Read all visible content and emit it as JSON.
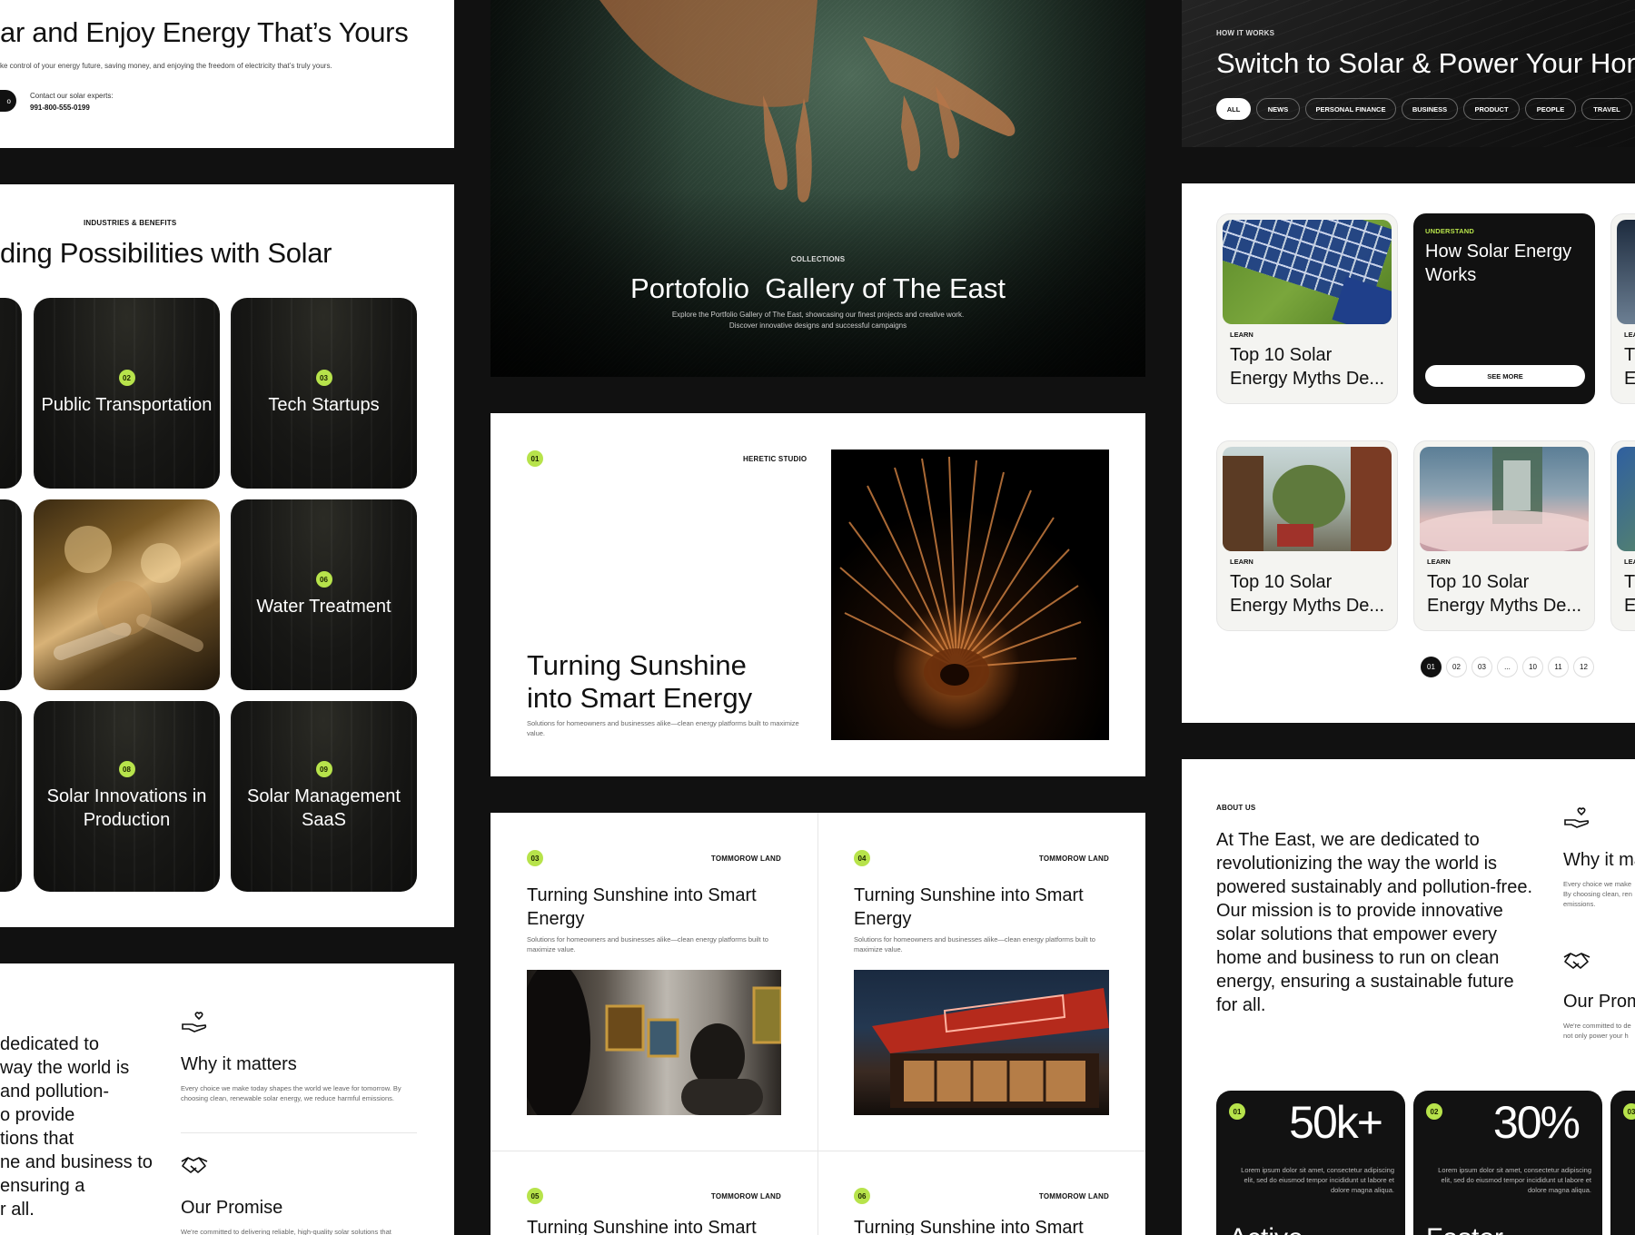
{
  "colors": {
    "accent": "#b7e34b",
    "background": "#111111",
    "panel": "#ffffff"
  },
  "hero_left": {
    "title": "ar and Enjoy Energy That’s Yours",
    "subtitle": "ke control of your energy future, saving money,  and enjoying the freedom of electricity that’s truly yours.",
    "button_fragment": "o",
    "contact_label": "Contact our solar experts:",
    "contact_phone": "991-800-555-0199"
  },
  "industries": {
    "eyebrow": "INDUSTRIES & BENEFITS",
    "title": "ding Possibilities with Solar",
    "tiles": [
      {
        "num": "02",
        "label": "Public Transportation"
      },
      {
        "num": "03",
        "label": "Tech Startups"
      },
      {
        "num": "06",
        "label": "Water Treatment"
      },
      {
        "num": "08",
        "label": "Solar Innovations in Production"
      },
      {
        "num": "09",
        "label": "Solar Management SaaS"
      }
    ]
  },
  "about_left": {
    "text": "dedicated to\nway the world is\nand pollution-\no provide\ntions that\nne and business to\nensuring a\nr all.",
    "item1_icon": "hand-heart-icon",
    "item1_title": "Why it matters",
    "item1_desc": "Every choice we make today shapes the world we leave for tomorrow. By choosing clean, renewable solar energy, we reduce harmful emissions.",
    "item2_icon": "handshake-icon",
    "item2_title": "Our Promise",
    "item2_desc": "We're committed to delivering reliable, high-quality solar solutions that"
  },
  "gallery_hero": {
    "eyebrow": "COLLECTIONS",
    "title": "Portofolio  Gallery of The East",
    "desc_line1": "Explore the Portfolio Gallery of The East, showcasing our finest projects and creative work.",
    "desc_line2": "Discover innovative designs and successful campaigns"
  },
  "feature": {
    "num": "01",
    "studio": "HERETIC STUDIO",
    "title": "Turning Sunshine into Smart Energy",
    "desc": "Solutions for homeowners and businesses alike—clean energy platforms built to maximize value."
  },
  "projects": [
    {
      "num": "03",
      "studio": "TOMMOROW LAND",
      "title": "Turning Sunshine into Smart Energy",
      "desc": "Solutions for homeowners and businesses alike—clean energy platforms built to maximize value."
    },
    {
      "num": "04",
      "studio": "TOMMOROW LAND",
      "title": "Turning Sunshine into Smart Energy",
      "desc": "Solutions for homeowners and businesses alike—clean energy platforms built to maximize value."
    },
    {
      "num": "05",
      "studio": "TOMMOROW LAND",
      "title": "Turning Sunshine into Smart"
    },
    {
      "num": "06",
      "studio": "TOMMOROW LAND",
      "title": "Turning Sunshine into Smart"
    }
  ],
  "how_it_works": {
    "eyebrow": "HOW IT WORKS",
    "title": "Switch to Solar & Power Your Home",
    "chips": [
      "ALL",
      "NEWS",
      "PERSONAL FINANCE",
      "BUSINESS",
      "PRODUCT",
      "PEOPLE",
      "TRAVEL"
    ]
  },
  "blog": {
    "cards": [
      {
        "tag": "LEARN",
        "title": "Top 10 Solar Energy Myths De..."
      },
      {
        "tag": "UNDERSTAND",
        "title": "How Solar Energy Works",
        "button": "SEE MORE"
      },
      {
        "tag": "LEA",
        "title": "T\nE"
      },
      {
        "tag": "LEARN",
        "title": "Top 10 Solar Energy Myths De..."
      },
      {
        "tag": "LEARN",
        "title": "Top 10 Solar Energy Myths De..."
      },
      {
        "tag": "LEA",
        "title": "T\nE"
      }
    ],
    "pagination": [
      "01",
      "02",
      "03",
      "...",
      "10",
      "11",
      "12"
    ],
    "current_page": "01"
  },
  "about_right": {
    "eyebrow": "ABOUT US",
    "text": "At The East, we are dedicated to revolutionizing the way the world is powered sustainably and pollution-free. Our mission is to provide innovative solar solutions that empower every home and business to run on clean energy, ensuring a sustainable future for all.",
    "item1_icon": "hand-heart-icon",
    "item1_title": "Why it ma",
    "item1_desc": "Every choice we make\nBy choosing clean, ren\nemissions.",
    "item2_icon": "handshake-icon",
    "item2_title": "Our Prom",
    "item2_desc": "We're committed to de\nnot only power your h",
    "stats": [
      {
        "num": "01",
        "value": "50k+",
        "desc": "Lorem ipsum dolor sit amet, consectetur adipiscing elit, sed do eiusmod tempor incididunt ut labore et dolore magna aliqua.",
        "word": "Active"
      },
      {
        "num": "02",
        "value": "30%",
        "desc": "Lorem ipsum dolor sit amet, consectetur adipiscing elit, sed do eiusmod tempor incididunt ut labore et dolore magna aliqua.",
        "word": "Faster"
      },
      {
        "num": "03"
      }
    ]
  }
}
